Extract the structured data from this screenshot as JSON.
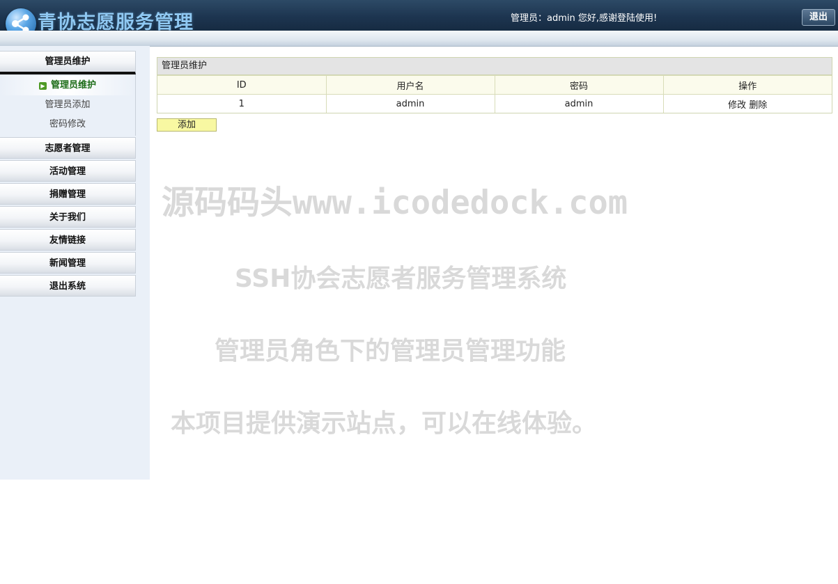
{
  "header": {
    "app_title": "青协志愿服务管理",
    "welcome": "管理员：admin 您好,感谢登陆使用!",
    "logout_label": "退出"
  },
  "sidebar": {
    "sections": [
      {
        "label": "管理员维护",
        "active": true,
        "items": [
          {
            "label": "管理员维护",
            "current": true
          },
          {
            "label": "管理员添加",
            "current": false
          },
          {
            "label": "密码修改",
            "current": false
          }
        ]
      },
      {
        "label": "志愿者管理"
      },
      {
        "label": "活动管理"
      },
      {
        "label": "捐赠管理"
      },
      {
        "label": "关于我们"
      },
      {
        "label": "友情链接"
      },
      {
        "label": "新闻管理"
      },
      {
        "label": "退出系统"
      }
    ]
  },
  "main": {
    "panel_title": "管理员维护",
    "columns": [
      "ID",
      "用户名",
      "密码",
      "操作"
    ],
    "rows": [
      {
        "id": "1",
        "username": "admin",
        "password": "admin",
        "edit": "修改",
        "delete": "删除"
      }
    ],
    "add_label": "添加"
  },
  "watermark": {
    "line1": "源码码头www.icodedock.com",
    "line2": "SSH协会志愿者服务管理系统",
    "line3": "管理员角色下的管理员管理功能",
    "line4": "本项目提供演示站点，可以在线体验。"
  },
  "colors": {
    "header_bg": "#1d3550",
    "sidebar_bg": "#eaf0f8",
    "current_item": "#1b6b16",
    "add_button_bg": "#f8f8a2",
    "watermark": "#d9d9d9"
  },
  "icons": {
    "logo": "share-nodes-icon",
    "current_item": "arrow-right-icon"
  }
}
